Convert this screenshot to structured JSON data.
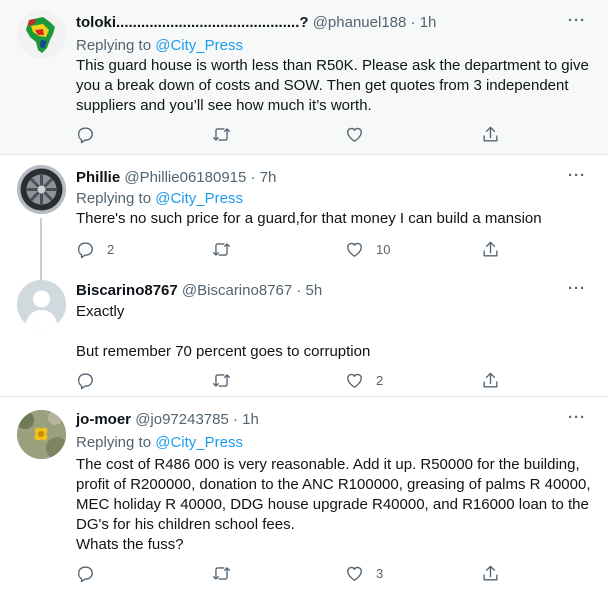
{
  "tweets": [
    {
      "name": "toloki............................................?",
      "handle": "@phanuel188",
      "dot": "·",
      "time": "1h",
      "reply_prefix": "Replying to",
      "reply_mention": "@City_Press",
      "text": "This guard house is worth less than R50K. Please ask the department to give you a break down of costs and SOW. Then get quotes from 3 independent suppliers and you’ll see how much it’s worth.",
      "replies": "",
      "retweets": "",
      "likes": "",
      "more": "···"
    },
    {
      "name": "Phillie",
      "handle": "@Phillie06180915",
      "dot": "·",
      "time": "7h",
      "reply_prefix": "Replying to",
      "reply_mention": "@City_Press",
      "text": "There's no such price for a guard,for that money I can build a mansion",
      "replies": "2",
      "retweets": "",
      "likes": "10",
      "more": "···"
    },
    {
      "name": "Biscarino8767",
      "handle": "@Biscarino8767",
      "dot": "·",
      "time": "5h",
      "text": "Exactly\n\nBut remember 70 percent goes to corruption",
      "replies": "",
      "retweets": "",
      "likes": "2",
      "more": "···"
    },
    {
      "name": "jo-moer",
      "handle": "@jo97243785",
      "dot": "·",
      "time": "1h",
      "reply_prefix": "Replying to",
      "reply_mention": "@City_Press",
      "text": "The cost of R486 000 is very reasonable. Add it up. R50000 for the building, profit of R200000, donation to the ANC R100000, greasing of palms R 40000, MEC holiday R 40000, DDG house upgrade R40000, and R16000 loan to the DG's for his children school fees.\nWhats the fuss?",
      "replies": "",
      "retweets": "",
      "likes": "3",
      "more": "···"
    }
  ],
  "icons": {
    "reply": "reply-icon",
    "retweet": "retweet-icon",
    "like": "heart-icon",
    "share": "share-icon"
  }
}
